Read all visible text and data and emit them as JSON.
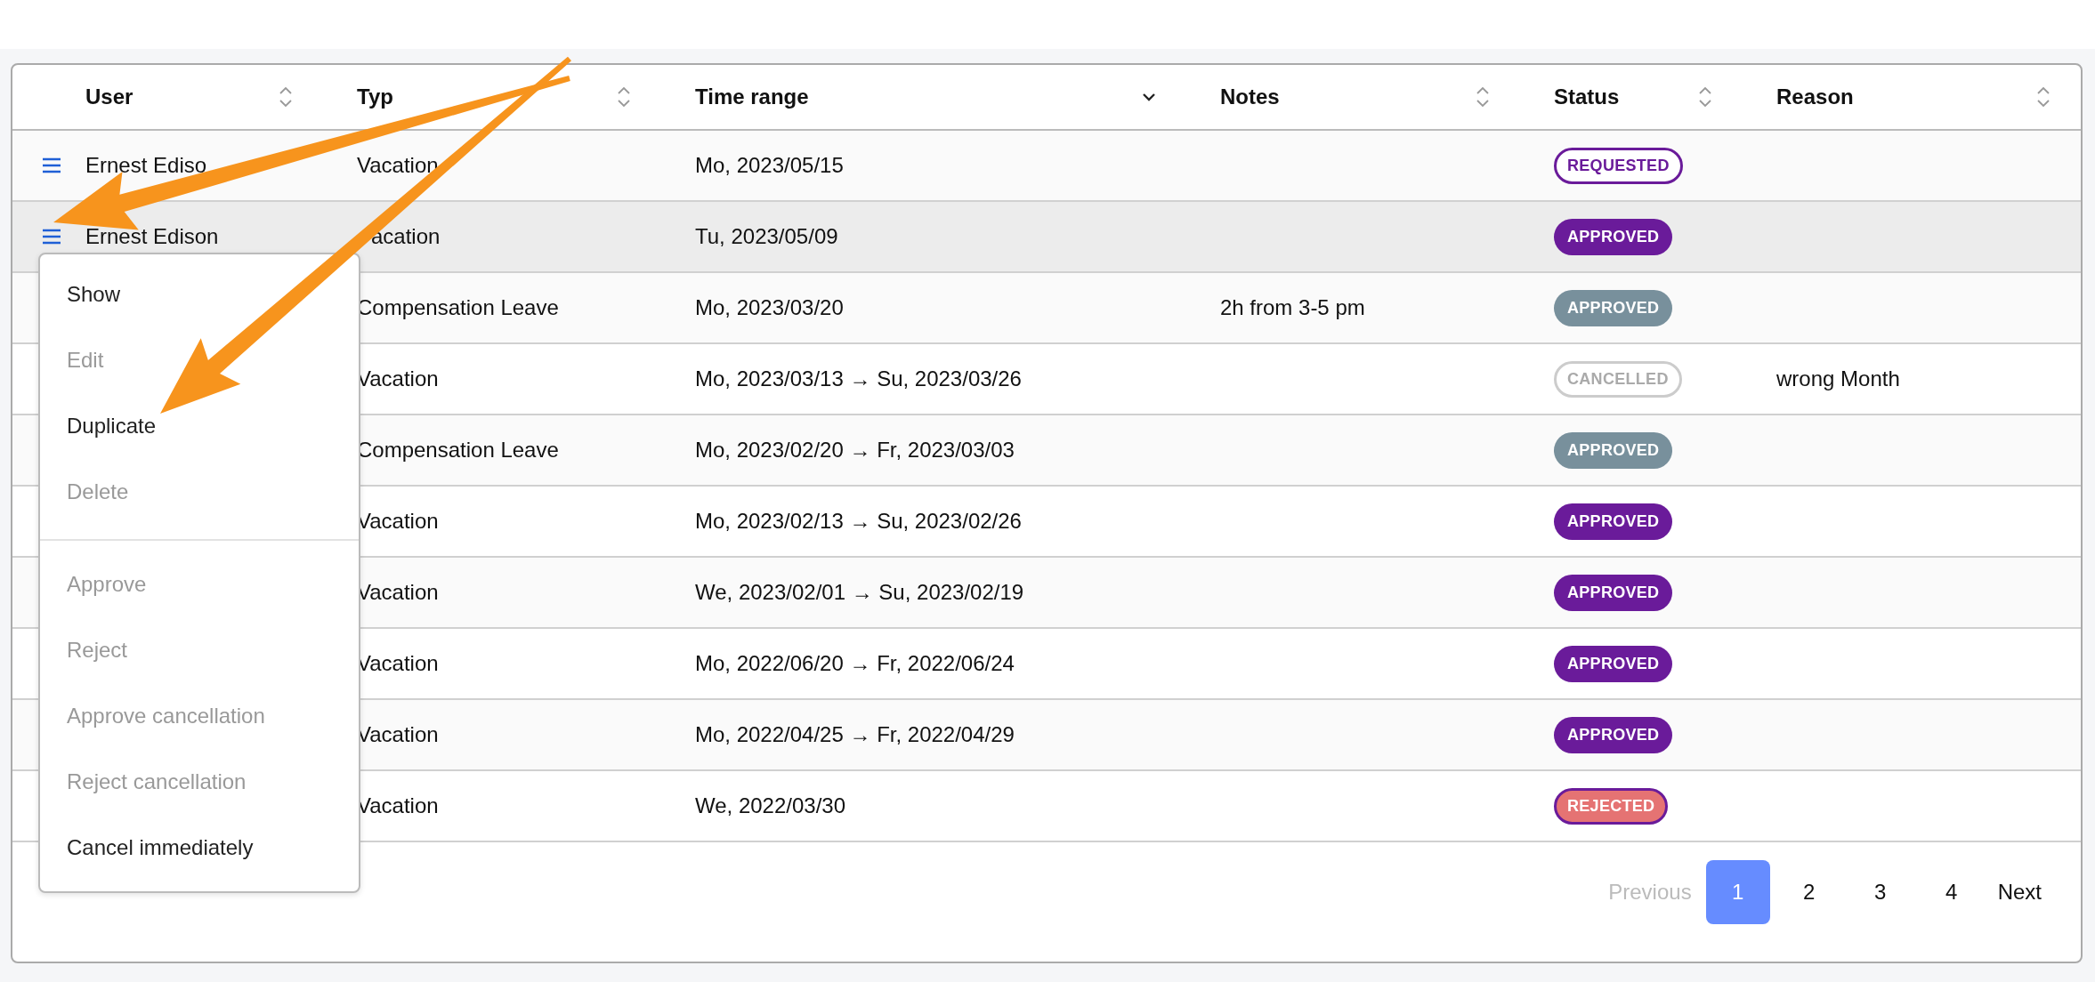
{
  "table": {
    "columns": [
      {
        "label": "User",
        "sorted": false
      },
      {
        "label": "Typ",
        "sorted": false
      },
      {
        "label": "Time range",
        "sorted": true
      },
      {
        "label": "Notes",
        "sorted": false
      },
      {
        "label": "Status",
        "sorted": false
      },
      {
        "label": "Reason",
        "sorted": false
      }
    ],
    "rows": [
      {
        "user": "Ernest Ediso",
        "type": "Vacation",
        "time_range": "Mo, 2023/05/15",
        "status": {
          "label": "REQUESTED",
          "kind": "requested"
        },
        "selected": false
      },
      {
        "user": "Ernest Edison",
        "type": "acation",
        "time_range": "Tu, 2023/05/09",
        "status": {
          "label": "APPROVED",
          "kind": "approved"
        },
        "selected": true
      },
      {
        "type": "Compensation Leave",
        "time_range": "Mo, 2023/03/20",
        "notes": "2h from 3-5 pm",
        "status": {
          "label": "APPROVED",
          "kind": "approved-muted"
        },
        "selected": false
      },
      {
        "type": "Vacation",
        "time_range": "Mo, 2023/03/13 → Su, 2023/03/26",
        "status": {
          "label": "CANCELLED",
          "kind": "cancelled"
        },
        "reason": "wrong Month",
        "selected": false
      },
      {
        "type": "Compensation Leave",
        "time_range": "Mo, 2023/02/20 → Fr, 2023/03/03",
        "status": {
          "label": "APPROVED",
          "kind": "approved-muted"
        },
        "selected": false
      },
      {
        "type": "Vacation",
        "time_range": "Mo, 2023/02/13 → Su, 2023/02/26",
        "status": {
          "label": "APPROVED",
          "kind": "approved"
        },
        "selected": false
      },
      {
        "type": "Vacation",
        "time_range": "We, 2023/02/01 → Su, 2023/02/19",
        "status": {
          "label": "APPROVED",
          "kind": "approved"
        },
        "selected": false
      },
      {
        "type": "Vacation",
        "time_range": "Mo, 2022/06/20 → Fr, 2022/06/24",
        "status": {
          "label": "APPROVED",
          "kind": "approved"
        },
        "selected": false
      },
      {
        "type": "Vacation",
        "time_range": "Mo, 2022/04/25 → Fr, 2022/04/29",
        "status": {
          "label": "APPROVED",
          "kind": "approved"
        },
        "selected": false
      },
      {
        "type": "Vacation",
        "time_range": "We, 2022/03/30",
        "status": {
          "label": "REJECTED",
          "kind": "rejected"
        },
        "selected": false
      }
    ]
  },
  "context_menu": {
    "groups": [
      [
        {
          "label": "Show",
          "disabled": false
        },
        {
          "label": "Edit",
          "disabled": true
        },
        {
          "label": "Duplicate",
          "disabled": false
        },
        {
          "label": "Delete",
          "disabled": true
        }
      ],
      [
        {
          "label": "Approve",
          "disabled": true
        },
        {
          "label": "Reject",
          "disabled": true
        },
        {
          "label": "Approve cancellation",
          "disabled": true
        },
        {
          "label": "Reject cancellation",
          "disabled": true
        },
        {
          "label": "Cancel immediately",
          "disabled": false
        }
      ]
    ]
  },
  "pagination": {
    "previous": {
      "label": "Previous",
      "disabled": true
    },
    "pages": [
      {
        "label": "1",
        "selected": true
      },
      {
        "label": "2",
        "selected": false
      },
      {
        "label": "3",
        "selected": false
      },
      {
        "label": "4",
        "selected": false
      }
    ],
    "next": {
      "label": "Next",
      "disabled": false
    }
  }
}
